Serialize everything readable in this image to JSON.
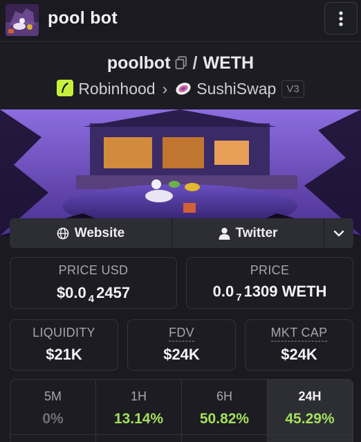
{
  "header": {
    "app_title": "pool bot",
    "menu_icon": "more-vertical-icon"
  },
  "pair": {
    "base_token": "poolbot",
    "separator": "/",
    "quote_token": "WETH",
    "chain": "Robinhood",
    "dex": "SushiSwap",
    "dex_version": "V3"
  },
  "links": {
    "website": "Website",
    "twitter": "Twitter"
  },
  "price_usd": {
    "label": "PRICE USD",
    "prefix": "$0.0",
    "zeros": "4",
    "digits": "2457"
  },
  "price_native": {
    "label": "PRICE",
    "prefix": "0.0",
    "zeros": "7",
    "digits": "1309",
    "unit": "WETH"
  },
  "metrics": [
    {
      "label": "LIQUIDITY",
      "value": "$21K"
    },
    {
      "label": "FDV",
      "value": "$24K"
    },
    {
      "label": "MKT CAP",
      "value": "$24K"
    }
  ],
  "timeframes": [
    {
      "label": "5M",
      "value": "0%",
      "color": "#6e6e78",
      "active": false
    },
    {
      "label": "1H",
      "value": "13.14%",
      "color": "#a3e05a",
      "active": false
    },
    {
      "label": "6H",
      "value": "50.82%",
      "color": "#a3e05a",
      "active": false
    },
    {
      "label": "24H",
      "value": "45.29%",
      "color": "#a3e05a",
      "active": true
    }
  ],
  "colors": {
    "background": "#1a1a20",
    "card_border": "#34343c",
    "positive": "#a3e05a",
    "chain_accent": "#c6f03c"
  }
}
